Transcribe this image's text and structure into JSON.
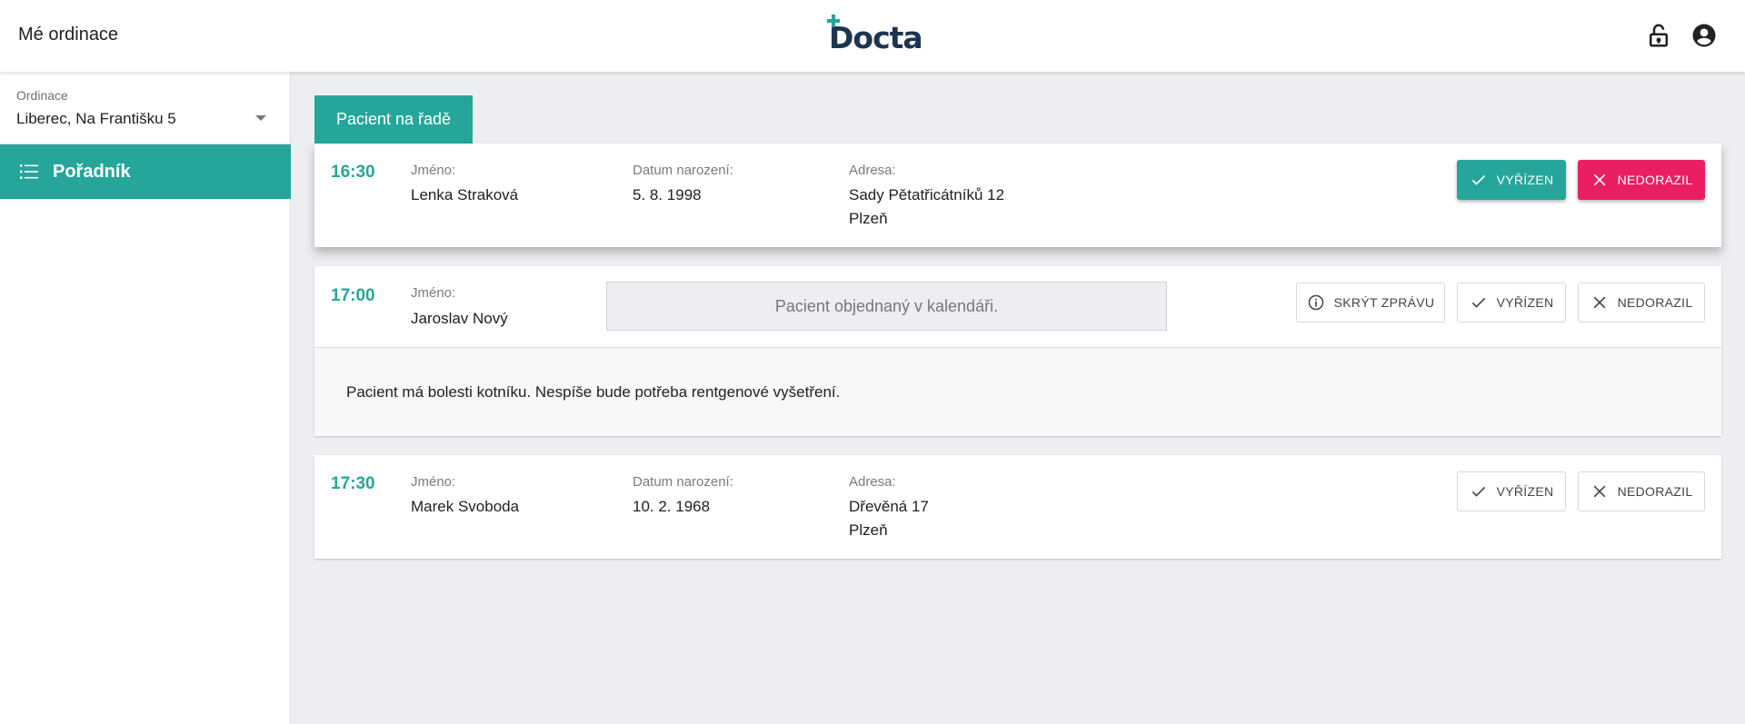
{
  "header": {
    "title": "Mé ordinace",
    "logo_text": "Docta",
    "icons": [
      "lock-icon",
      "account-icon"
    ]
  },
  "sidebar": {
    "clinic_label": "Ordinace",
    "clinic_value": "Liberec, Na Františku 5",
    "nav": [
      {
        "label": "Pořadník",
        "icon": "list-icon",
        "active": true
      }
    ]
  },
  "main": {
    "tab_label": "Pacient na řadě",
    "appointments": [
      {
        "time": "16:30",
        "name_label": "Jméno:",
        "name": "Lenka Straková",
        "dob_label": "Datum narození:",
        "dob": "5. 8. 1998",
        "address_label": "Adresa:",
        "address_line1": "Sady Pětatřicátníků 12",
        "address_line2": "Plzeň",
        "done_label": "VYŘÍZEN",
        "noshow_label": "NEDORAZIL"
      },
      {
        "time": "17:00",
        "name_label": "Jméno:",
        "name": "Jaroslav Nový",
        "note": "Pacient objednaný v kalendáři.",
        "hide_message_label": "SKRÝT ZPRÁVU",
        "done_label": "VYŘÍZEN",
        "noshow_label": "NEDORAZIL",
        "message": "Pacient má bolesti kotníku. Nespíše bude potřeba rentgenové vyšetření."
      },
      {
        "time": "17:30",
        "name_label": "Jméno:",
        "name": "Marek Svoboda",
        "dob_label": "Datum narození:",
        "dob": "10. 2. 1968",
        "address_label": "Adresa:",
        "address_line1": "Dřevěná 17",
        "address_line2": "Plzeň",
        "done_label": "VYŘÍZEN",
        "noshow_label": "NEDORAZIL"
      }
    ]
  },
  "colors": {
    "accent": "#26a69a",
    "danger": "#e91e63",
    "logo": "#1b3550",
    "background": "#eceef1"
  }
}
